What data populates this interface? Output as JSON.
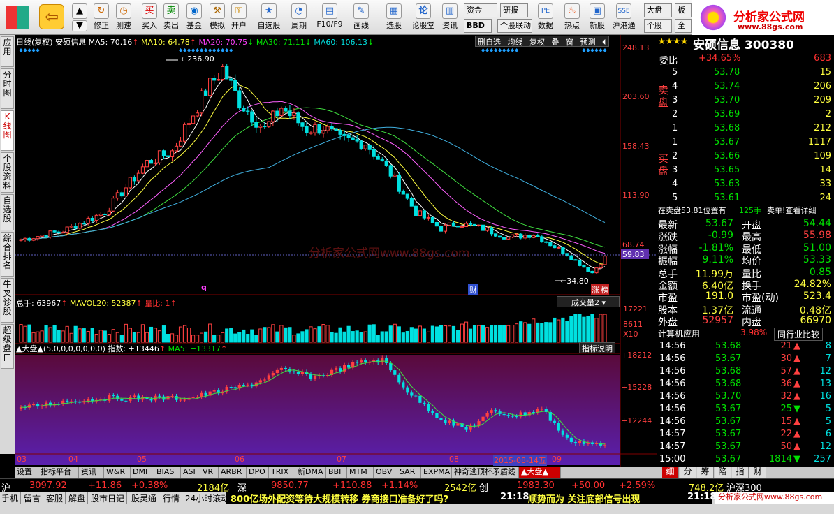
{
  "toolbar": {
    "buttons": [
      "修正",
      "测速",
      "买入",
      "卖出",
      "基金",
      "模拟",
      "开户",
      "自选股",
      "周期",
      "F10/F9",
      "画线",
      "选股",
      "论股堂",
      "资讯",
      "数据",
      "热点",
      "新股",
      "沪港通"
    ],
    "pills": [
      "资金",
      "研报",
      "BBD",
      "个股联动",
      "大盘",
      "个股",
      "板",
      "全"
    ]
  },
  "logo": {
    "title": "分析家公式网",
    "url": "www.88gs.com"
  },
  "left_tabs": [
    "应用",
    "分时图",
    "K线图",
    "个股资料",
    "自选股",
    "综合排名",
    "牛叉诊股",
    "超级盘口"
  ],
  "chart_header": {
    "period": "日线(复权)",
    "name": "安硕信息",
    "ma5": "MA5: 70.16",
    "ma10": "MA10: 64.78",
    "ma20": "MA20: 70.75",
    "ma30": "MA30: 71.11",
    "ma60": "MA60: 106.13"
  },
  "chart_toolbar": [
    "删自选",
    "均线",
    "复权",
    "叠",
    "窗",
    "预测"
  ],
  "price_axis": [
    "248.13",
    "203.60",
    "158.43",
    "113.90",
    "68.74",
    "59.83"
  ],
  "price_markers": {
    "high": "236.90",
    "low": "34.80"
  },
  "watermark": "分析家公式网www.88gs.com",
  "marks": {
    "q": "q",
    "cai": "财",
    "zhang": "涨",
    "bang": "榜"
  },
  "volume_header": {
    "total": "总手: 63967",
    "mavol": "MAVOL20: 52387",
    "ratio": "量比: 1",
    "selector": "成交量2"
  },
  "volume_axis": [
    "17221",
    "8611",
    "X10"
  ],
  "index_header": {
    "name": "▲大盘▲(5,0,0,0,0,0,0,0)",
    "index": "指数: +13446",
    "ma5": "MA5: +13317",
    "btn": "指标说明"
  },
  "index_axis": [
    "+18212",
    "+15228",
    "+12244"
  ],
  "x_axis": [
    "03",
    "04",
    "05",
    "06",
    "07",
    "08",
    "09"
  ],
  "date_cursor": "2015-08-14五",
  "bottom_tabs": [
    "设置",
    "指标平台",
    "资讯",
    "W&R",
    "DMI",
    "BIAS",
    "ASI",
    "VR",
    "ARBR",
    "DPO",
    "TRIX",
    "新DMA",
    "BBI",
    "MTM",
    "OBV",
    "SAR",
    "EXPMA",
    "神奇逃顶杯矛盾线",
    "▲大盘▲"
  ],
  "stock": {
    "title": "安硕信息 300380",
    "weibi_label": "委比",
    "weibi": "+34.65%",
    "weibi_n": "683",
    "sell_label": "卖盘",
    "buy_label": "买盘",
    "sell": [
      [
        "5",
        "53.78",
        "15"
      ],
      [
        "4",
        "53.74",
        "206"
      ],
      [
        "3",
        "53.70",
        "209"
      ],
      [
        "2",
        "53.69",
        "2"
      ],
      [
        "1",
        "53.68",
        "212"
      ]
    ],
    "buy": [
      [
        "1",
        "53.67",
        "1117"
      ],
      [
        "2",
        "53.66",
        "109"
      ],
      [
        "3",
        "53.65",
        "14"
      ],
      [
        "4",
        "53.63",
        "33"
      ],
      [
        "5",
        "53.61",
        "24"
      ]
    ],
    "notice_left": "在卖盘53.81位置有",
    "notice_mid": "125手",
    "notice_right": "卖单!查看详细",
    "quotes": [
      [
        "最新",
        "53.67",
        "开盘",
        "54.44"
      ],
      [
        "涨跌",
        "-0.99",
        "最高",
        "55.98"
      ],
      [
        "涨幅",
        "-1.81%",
        "最低",
        "51.00"
      ],
      [
        "振幅",
        "9.11%",
        "均价",
        "53.33"
      ],
      [
        "总手",
        "11.99万",
        "量比",
        "0.85"
      ],
      [
        "金额",
        "6.40亿",
        "换手",
        "24.82%"
      ],
      [
        "市盈",
        "191.0",
        "市盈(动)",
        "523.4"
      ],
      [
        "股本",
        "1.37亿",
        "流通",
        "0.48亿"
      ],
      [
        "外盘",
        "52957",
        "内盘",
        "66970"
      ]
    ],
    "industry": "计算机应用",
    "industry_pct": "3.98%",
    "industry_btn": "同行业比较",
    "ticks": [
      [
        "14:56",
        "53.68",
        "21",
        "8"
      ],
      [
        "14:56",
        "53.67",
        "30",
        "7"
      ],
      [
        "14:56",
        "53.68",
        "57",
        "12"
      ],
      [
        "14:56",
        "53.68",
        "36",
        "13"
      ],
      [
        "14:56",
        "53.70",
        "32",
        "16"
      ],
      [
        "14:56",
        "53.67",
        "25",
        "5"
      ],
      [
        "14:56",
        "53.67",
        "15",
        "5"
      ],
      [
        "14:57",
        "53.67",
        "22",
        "6"
      ],
      [
        "14:57",
        "53.67",
        "50",
        "12"
      ],
      [
        "15:00",
        "53.67",
        "1814",
        "257"
      ]
    ],
    "tick_dir": [
      "up",
      "up",
      "up",
      "up",
      "up",
      "down",
      "up",
      "up",
      "up",
      "down"
    ],
    "right_tabs": [
      "细",
      "分",
      "筹",
      "陷",
      "指",
      "财"
    ]
  },
  "status": {
    "sh_label": "沪",
    "sh_val": "3097.92",
    "sh_chg": "+11.86",
    "sh_pct": "+0.38%",
    "sh_amt": "2184亿",
    "sz_label": "深",
    "sz_val": "9850.77",
    "sz_chg": "+110.88",
    "sz_pct": "+1.14%",
    "sz_amt": "2542亿",
    "cy_label": "创",
    "cy_val": "1983.30",
    "cy_chg": "+50.00",
    "cy_pct": "+2.59%",
    "cy_amt": "748.2亿",
    "hs_label": "沪深300"
  },
  "status2": {
    "items": [
      "手机",
      "留言",
      "客服",
      "解盘",
      "股市日记",
      "股灵通",
      "行情",
      "24小时滚动"
    ],
    "news1": "800亿场外配资等待大规模转移 券商接口准备好了吗?",
    "t1": "21:18",
    "news2": "顺势而为 关注底部信号出现",
    "t2": "21:18",
    "site": "分析家公式网www.88gs.com"
  }
}
